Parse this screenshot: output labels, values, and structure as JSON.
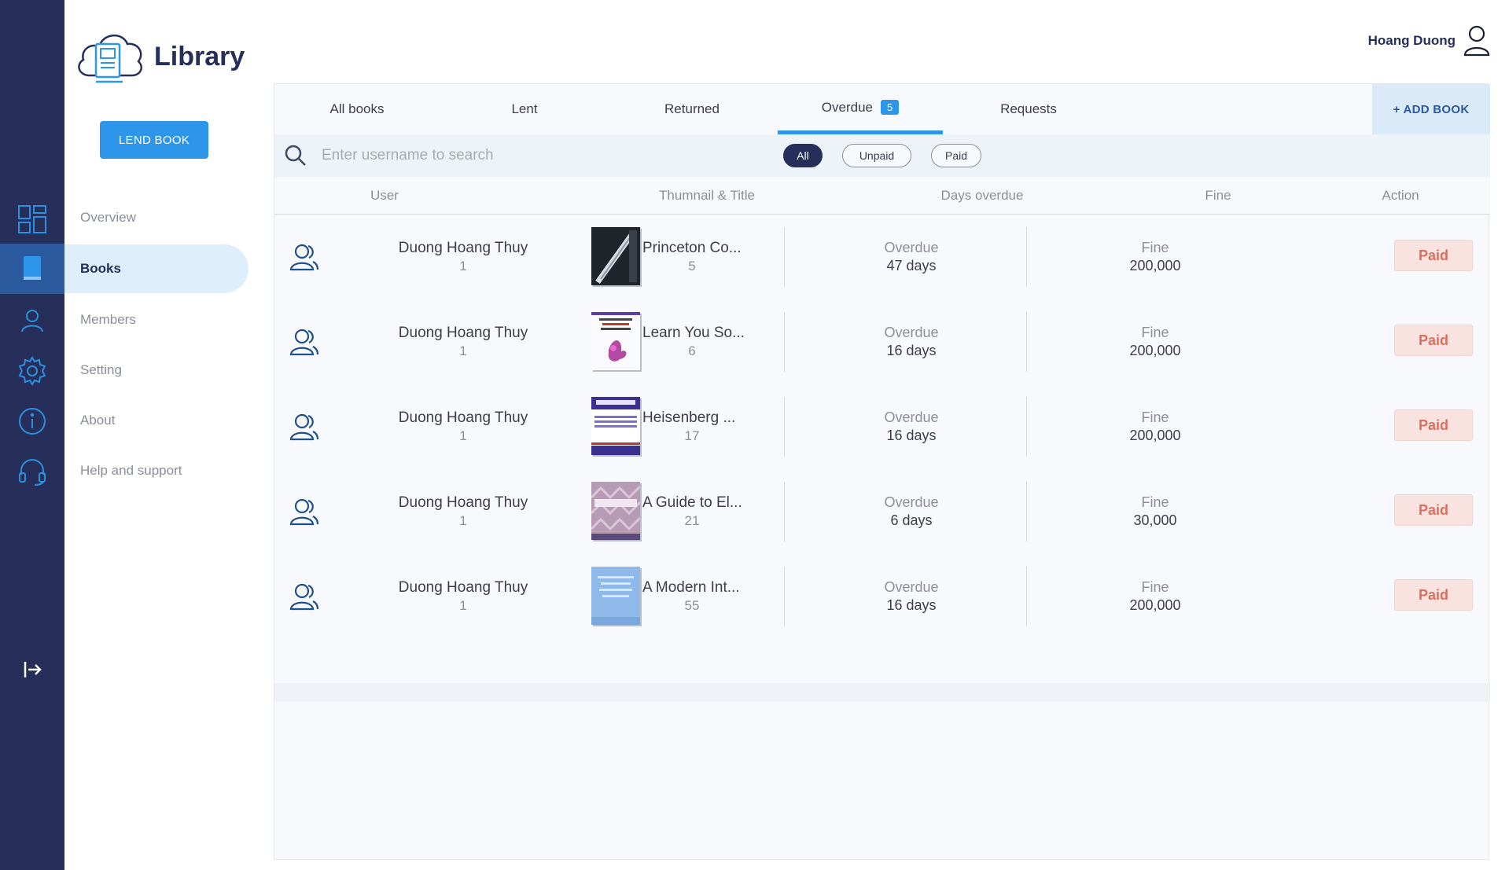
{
  "app": {
    "name": "Library"
  },
  "sidebar": {
    "lend_button": "LEND BOOK",
    "items": [
      {
        "label": "Overview",
        "icon": "dashboard-icon",
        "active": false
      },
      {
        "label": "Books",
        "icon": "book-icon",
        "active": true
      },
      {
        "label": "Members",
        "icon": "members-icon",
        "active": false
      },
      {
        "label": "Setting",
        "icon": "gear-icon",
        "active": false
      },
      {
        "label": "About",
        "icon": "info-icon",
        "active": false
      },
      {
        "label": "Help and support",
        "icon": "headset-icon",
        "active": false
      }
    ],
    "logout_icon": "logout-icon"
  },
  "header": {
    "user_name": "Hoang Duong",
    "user_icon": "user-icon"
  },
  "tabs": [
    {
      "label": "All books"
    },
    {
      "label": "Lent"
    },
    {
      "label": "Returned"
    },
    {
      "label": "Overdue",
      "badge": "5",
      "active": true
    },
    {
      "label": "Requests"
    }
  ],
  "add_book": "+ ADD BOOK",
  "search": {
    "placeholder": "Enter username to search",
    "value": ""
  },
  "filters": [
    {
      "label": "All",
      "active": true
    },
    {
      "label": "Unpaid",
      "active": false
    },
    {
      "label": "Paid",
      "active": false
    }
  ],
  "columns": [
    "User",
    "Thumnail & Title",
    "Days overdue",
    "Fine",
    "Action"
  ],
  "rows": [
    {
      "user": "Duong Hoang Thuy",
      "user_id": "1",
      "title": "Princeton Co...",
      "book_id": "5",
      "overdue_label": "Overdue",
      "overdue": "47 days",
      "fine_label": "Fine",
      "fine": "200,000",
      "action": "Paid"
    },
    {
      "user": "Duong Hoang Thuy",
      "user_id": "1",
      "title": "Learn You So...",
      "book_id": "6",
      "overdue_label": "Overdue",
      "overdue": "16 days",
      "fine_label": "Fine",
      "fine": "200,000",
      "action": "Paid"
    },
    {
      "user": "Duong Hoang Thuy",
      "user_id": "1",
      "title": "Heisenberg ...",
      "book_id": "17",
      "overdue_label": "Overdue",
      "overdue": "16 days",
      "fine_label": "Fine",
      "fine": "200,000",
      "action": "Paid"
    },
    {
      "user": "Duong Hoang Thuy",
      "user_id": "1",
      "title": "A Guide to El...",
      "book_id": "21",
      "overdue_label": "Overdue",
      "overdue": "6 days",
      "fine_label": "Fine",
      "fine": "30,000",
      "action": "Paid"
    },
    {
      "user": "Duong Hoang Thuy",
      "user_id": "1",
      "title": "A Modern Int...",
      "book_id": "55",
      "overdue_label": "Overdue",
      "overdue": "16 days",
      "fine_label": "Fine",
      "fine": "200,000",
      "action": "Paid"
    }
  ],
  "colors": {
    "rail": "#262f5a",
    "accent": "#2d96ea",
    "paid_bg": "#f9e3e0",
    "paid_text": "#d9705b"
  }
}
